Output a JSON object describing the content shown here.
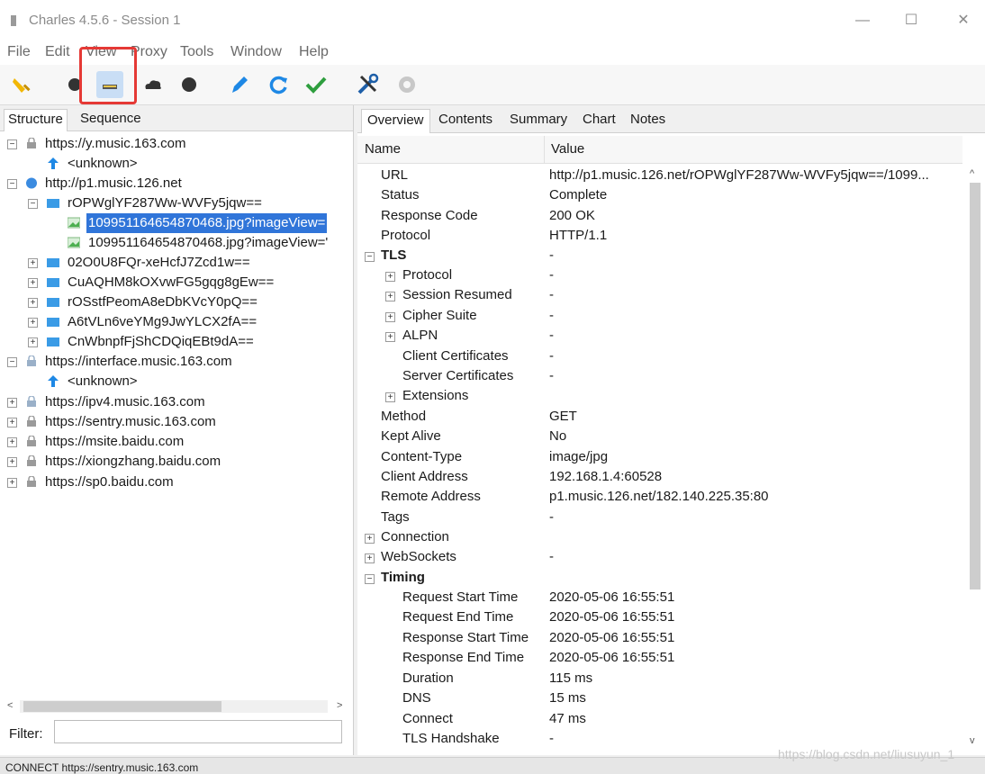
{
  "window": {
    "title": "Charles 4.5.6 - Session 1",
    "controls": [
      "—",
      "☐",
      "✕"
    ]
  },
  "menu": [
    "File",
    "Edit",
    "View",
    "Proxy",
    "Tools",
    "Window",
    "Help"
  ],
  "left_tabs": [
    "Structure",
    "Sequence"
  ],
  "tree": {
    "host1": "https://y.music.163.com",
    "unknown1": "<unknown>",
    "host2": "http://p1.music.126.net",
    "folder1": "rOPWglYF287Ww-WVFy5jqw==",
    "file1": "109951164654870468.jpg?imageView=",
    "file2": "109951164654870468.jpg?imageView='",
    "folder2": "02O0U8FQr-xeHcfJ7Zcd1w==",
    "folder3": "CuAQHM8kOXvwFG5gqg8gEw==",
    "folder4": "rOSstfPeomA8eDbKVcY0pQ==",
    "folder5": "A6tVLn6veYMg9JwYLCX2fA==",
    "folder6": "CnWbnpfFjShCDQiqEBt9dA==",
    "host3": "https://interface.music.163.com",
    "unknown2": "<unknown>",
    "host4": "https://ipv4.music.163.com",
    "host5": "https://sentry.music.163.com",
    "host6": "https://msite.baidu.com",
    "host7": "https://xiongzhang.baidu.com",
    "host8": "https://sp0.baidu.com"
  },
  "filter_label": "Filter:",
  "right_tabs": [
    "Overview",
    "Contents",
    "Summary",
    "Chart",
    "Notes"
  ],
  "overview": {
    "col_name": "Name",
    "col_value": "Value",
    "rows": {
      "url": [
        "URL",
        "http://p1.music.126.net/rOPWglYF287Ww-WVFy5jqw==/1099..."
      ],
      "status": [
        "Status",
        "Complete"
      ],
      "response_code": [
        "Response Code",
        "200 OK"
      ],
      "protocol": [
        "Protocol",
        "HTTP/1.1"
      ],
      "tls": [
        "TLS",
        "-"
      ],
      "tls_protocol": [
        "Protocol",
        "-"
      ],
      "session_resumed": [
        "Session Resumed",
        "-"
      ],
      "cipher_suite": [
        "Cipher Suite",
        "-"
      ],
      "alpn": [
        "ALPN",
        "-"
      ],
      "client_certs": [
        "Client Certificates",
        "-"
      ],
      "server_certs": [
        "Server Certificates",
        "-"
      ],
      "extensions": [
        "Extensions",
        ""
      ],
      "method": [
        "Method",
        "GET"
      ],
      "kept_alive": [
        "Kept Alive",
        "No"
      ],
      "content_type": [
        "Content-Type",
        "image/jpg"
      ],
      "client_address": [
        "Client Address",
        "192.168.1.4:60528"
      ],
      "remote_address": [
        "Remote Address",
        "p1.music.126.net/182.140.225.35:80"
      ],
      "tags": [
        "Tags",
        "-"
      ],
      "connection": [
        "Connection",
        ""
      ],
      "websockets": [
        "WebSockets",
        "-"
      ],
      "timing": [
        "Timing",
        ""
      ],
      "req_start": [
        "Request Start Time",
        "2020-05-06 16:55:51"
      ],
      "req_end": [
        "Request End Time",
        "2020-05-06 16:55:51"
      ],
      "resp_start": [
        "Response Start Time",
        "2020-05-06 16:55:51"
      ],
      "resp_end": [
        "Response End Time",
        "2020-05-06 16:55:51"
      ],
      "duration": [
        "Duration",
        "115 ms"
      ],
      "dns": [
        "DNS",
        "15 ms"
      ],
      "connect": [
        "Connect",
        "47 ms"
      ],
      "tls_handshake": [
        "TLS Handshake",
        "-"
      ]
    }
  },
  "status_bar": "CONNECT https://sentry.music.163.com",
  "watermark": "https://blog.csdn.net/liusuyun_1",
  "colors": {
    "selection": "#3075d9",
    "highlight_box": "#e53935",
    "accent_blue": "#1e88e5"
  }
}
